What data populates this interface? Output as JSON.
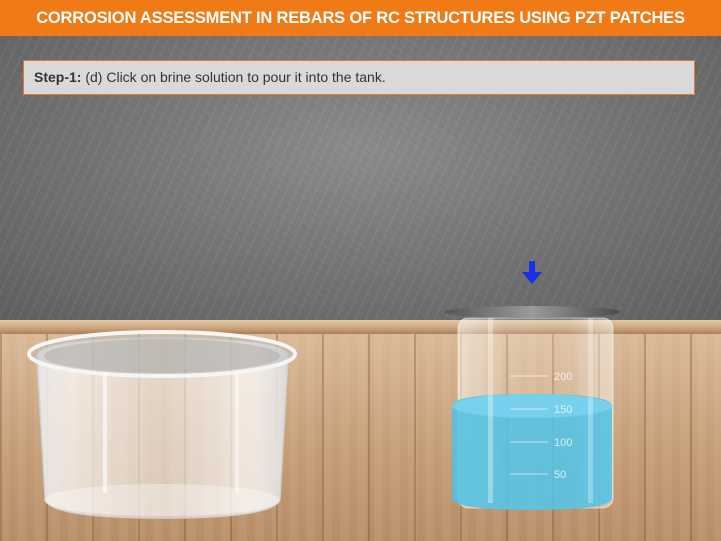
{
  "header": {
    "title": "CORROSION ASSESSMENT IN REBARS OF RC STRUCTURES USING PZT PATCHES"
  },
  "instruction": {
    "step": "Step-1:",
    "text": " (d) Click on brine solution to pour it into the tank."
  },
  "beaker": {
    "labels": [
      "200",
      "150",
      "100",
      "50"
    ],
    "liquid_color": "#4fc3e8"
  },
  "colors": {
    "header": "#f07a16",
    "arrow": "#1a2fe6"
  }
}
